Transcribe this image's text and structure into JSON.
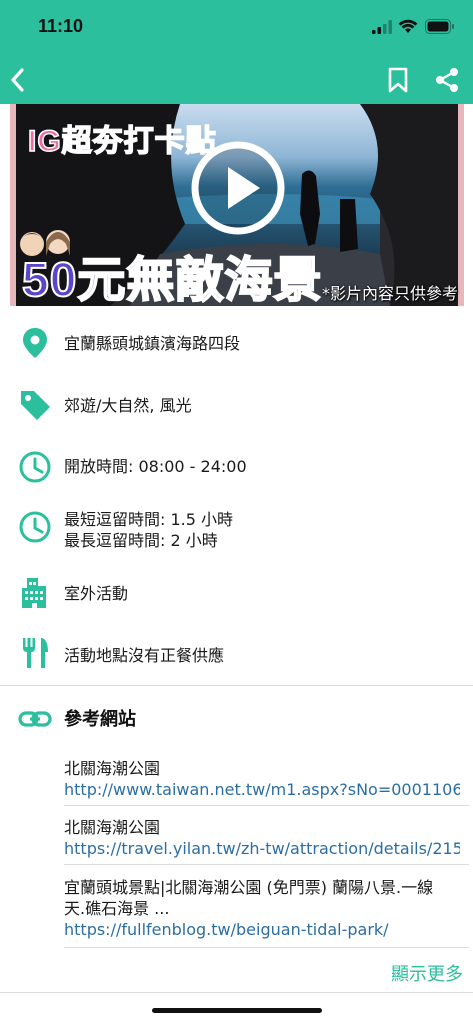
{
  "status_bar": {
    "time": "11:10"
  },
  "colors": {
    "brand": "#2bbf9d",
    "link": "#2b6ea3",
    "media_title": "#5b45c9",
    "media_tag": "#f06b9e"
  },
  "nav": {
    "back_icon": "chevron-left-icon",
    "bookmark_icon": "bookmark-icon",
    "share_icon": "share-icon"
  },
  "media": {
    "tag": "IG超夯打卡點",
    "title": "50元無敵海景",
    "note": "*影片內容只供參考",
    "play_icon": "play-icon"
  },
  "details": {
    "address": "宜蘭縣頭城鎮濱海路四段",
    "category": "郊遊/大自然, 風光",
    "hours": "開放時間: 08:00 - 24:00",
    "min_stay": "最短逗留時間: 1.5 小時",
    "max_stay": "最長逗留時間: 2 小時",
    "activity": "室外活動",
    "food": "活動地點沒有正餐供應"
  },
  "references": {
    "title": "參考網站",
    "items": [
      {
        "name": "北關海潮公園",
        "url": "http://www.taiwan.net.tw/m1.aspx?sNo=0001106..."
      },
      {
        "name": "北關海潮公園",
        "url": "https://travel.yilan.tw/zh-tw/attraction/details/215"
      },
      {
        "name": "宜蘭頭城景點|北關海潮公園 (免門票) 蘭陽八景.一線",
        "name2": "天.礁石海景 ...",
        "url": "https://fullfenblog.tw/beiguan-tidal-park/"
      }
    ],
    "more": "顯示更多"
  }
}
